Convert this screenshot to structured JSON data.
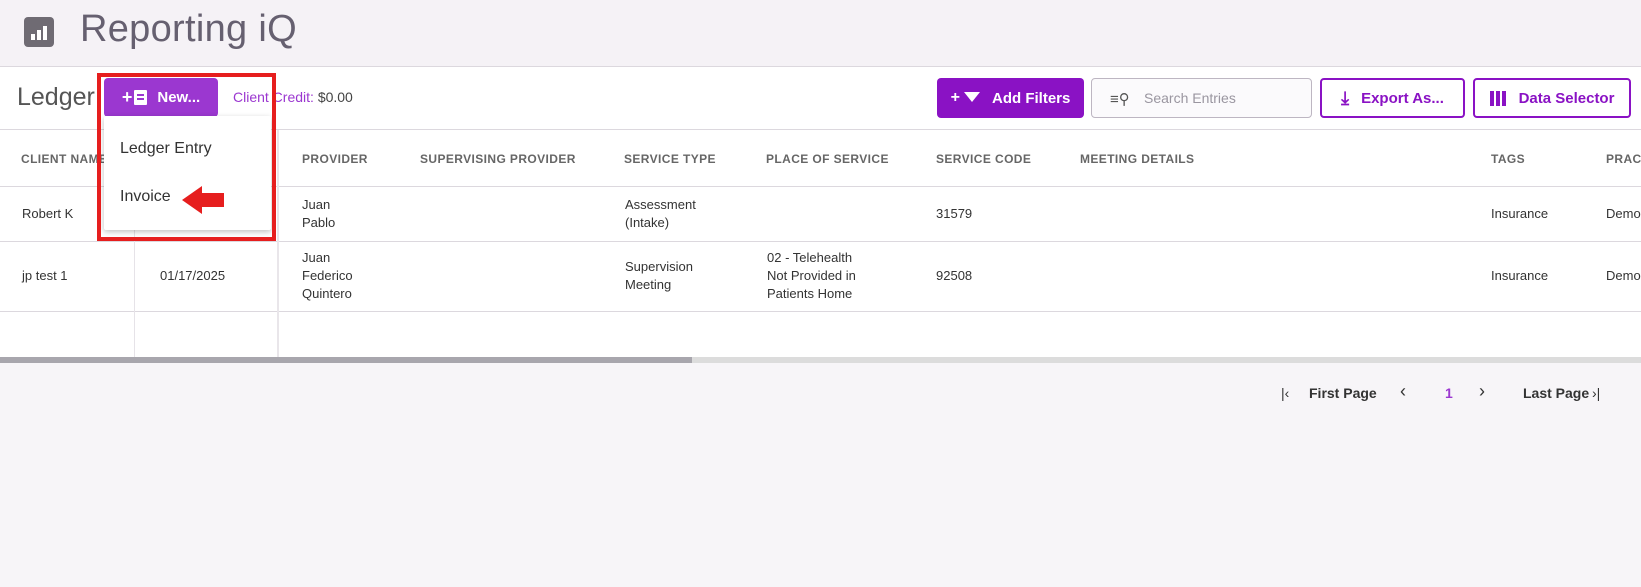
{
  "app": {
    "title": "Reporting iQ",
    "icon": "bar-chart-icon"
  },
  "toolbar": {
    "page_title": "Ledger",
    "new_label": "New...",
    "credit_label": "Client Credit:",
    "credit_value": "$0.00",
    "add_filters_label": "Add Filters",
    "search_placeholder": "Search Entries",
    "export_label": "Export As...",
    "data_selector_label": "Data Selector"
  },
  "dropdown": {
    "items": [
      "Ledger Entry",
      "Invoice"
    ]
  },
  "table": {
    "headers": [
      "CLIENT NAME",
      "PROVIDER",
      "SUPERVISING PROVIDER",
      "SERVICE TYPE",
      "PLACE OF SERVICE",
      "SERVICE CODE",
      "MEETING DETAILS",
      "TAGS",
      "PRACT"
    ],
    "rows": [
      {
        "client": "Robert K",
        "date": "",
        "provider": [
          "Juan",
          "Pablo"
        ],
        "supervising": "",
        "service_type": [
          "Assessment",
          "(Intake)"
        ],
        "place": [],
        "code": "31579",
        "meeting": "",
        "tags": "Insurance",
        "practice": "Demo"
      },
      {
        "client": "jp test 1",
        "date": "01/17/2025",
        "provider": [
          "Juan",
          "Federico",
          "Quintero"
        ],
        "supervising": "",
        "service_type": [
          "Supervision",
          "Meeting"
        ],
        "place": [
          "02 - Telehealth",
          "Not Provided in",
          "Patients Home"
        ],
        "code": "92508",
        "meeting": "",
        "tags": "Insurance",
        "practice": "Demo"
      }
    ]
  },
  "pager": {
    "first": "First Page",
    "current": "1",
    "last": "Last Page"
  },
  "colors": {
    "accent": "#8a12c4",
    "accent_light": "#9b37d0",
    "highlight": "#e61e1e"
  }
}
